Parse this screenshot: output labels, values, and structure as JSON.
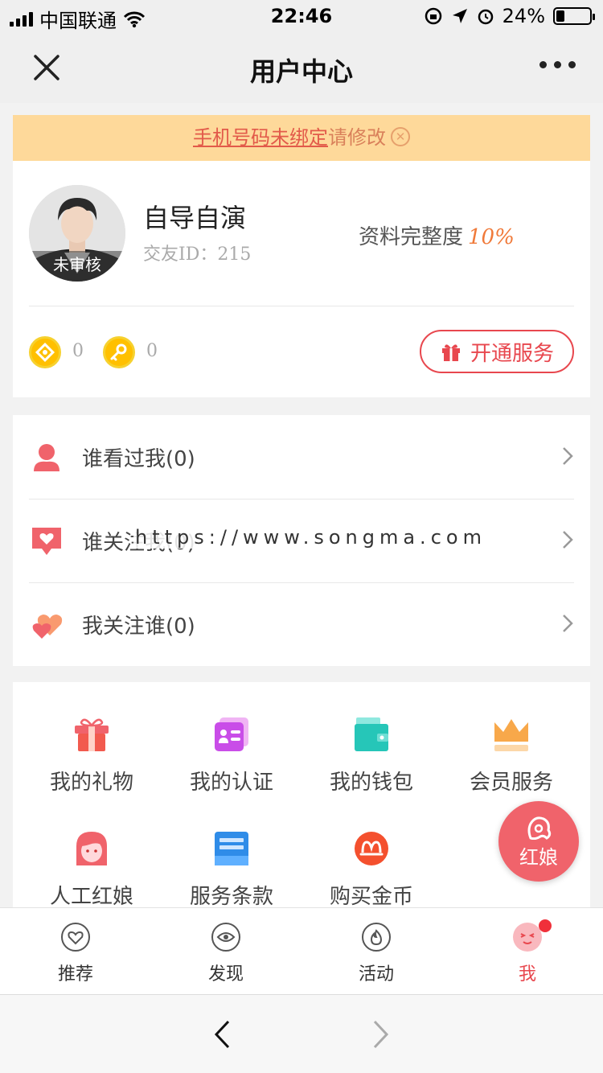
{
  "status_bar": {
    "carrier": "中国联通",
    "time": "22:46",
    "battery": "24%"
  },
  "nav": {
    "title": "用户中心"
  },
  "notice": {
    "link_text": "手机号码未绑定",
    "suffix_text": "请修改"
  },
  "profile": {
    "avatar_badge": "未审核",
    "username": "自导自演",
    "uid_label": "交友ID：215",
    "completeness_label": "资料完整度",
    "completeness_value": "10%",
    "coins": "0",
    "keys": "0",
    "open_service_label": "开通服务"
  },
  "menu": {
    "items": [
      {
        "label": "谁看过我(0)",
        "icon": "person-icon"
      },
      {
        "label": "谁关注我(0)",
        "icon": "heart-message-icon"
      },
      {
        "label": "我关注谁(0)",
        "icon": "double-heart-icon"
      }
    ]
  },
  "watermark": "https://www.songma.com",
  "grid": {
    "items": [
      {
        "label": "我的礼物",
        "icon": "gift-icon"
      },
      {
        "label": "我的认证",
        "icon": "id-card-icon"
      },
      {
        "label": "我的钱包",
        "icon": "wallet-icon"
      },
      {
        "label": "会员服务",
        "icon": "crown-icon"
      },
      {
        "label": "人工红娘",
        "icon": "matchmaker-icon"
      },
      {
        "label": "服务条款",
        "icon": "document-icon"
      },
      {
        "label": "购买金币",
        "icon": "buy-coin-icon"
      }
    ]
  },
  "floating": {
    "label": "红娘"
  },
  "tabbar": {
    "tabs": [
      {
        "label": "推荐",
        "icon": "heart-circle-icon"
      },
      {
        "label": "发现",
        "icon": "eye-icon"
      },
      {
        "label": "活动",
        "icon": "flame-icon"
      },
      {
        "label": "我",
        "icon": "face-icon",
        "active": true
      }
    ]
  },
  "colors": {
    "accent": "#e8474e",
    "notice_bg": "#fed99a",
    "completeness": "#f07a3a"
  }
}
